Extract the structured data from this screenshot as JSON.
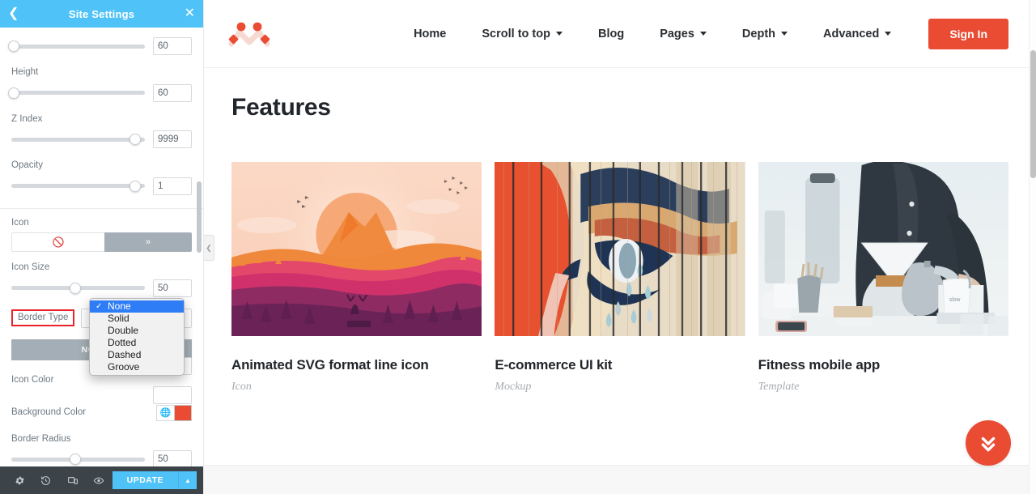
{
  "panel": {
    "header": {
      "title": "Site Settings",
      "back_icon": "chevron-left-icon",
      "close_icon": "close-icon"
    },
    "controls": [
      {
        "label": "",
        "value": "60",
        "knob_pct": 2
      },
      {
        "label": "Height",
        "value": "60",
        "knob_pct": 2
      },
      {
        "label": "Z Index",
        "value": "9999",
        "knob_pct": 93
      },
      {
        "label": "Opacity",
        "value": "1",
        "knob_pct": 93
      }
    ],
    "icon_section": {
      "label": "Icon",
      "picker_icon": "ban-icon",
      "more_icon": "double-chevron-down-icon"
    },
    "icon_size": {
      "label": "Icon Size",
      "value": "50",
      "knob_pct": 48
    },
    "border_type": {
      "label": "Border Type",
      "selected": "None"
    },
    "border_type_options": [
      {
        "label": "None",
        "selected": true
      },
      {
        "label": "Solid",
        "selected": false
      },
      {
        "label": "Double",
        "selected": false
      },
      {
        "label": "Dotted",
        "selected": false
      },
      {
        "label": "Dashed",
        "selected": false
      },
      {
        "label": "Groove",
        "selected": false
      }
    ],
    "tabs": [
      {
        "label": "NORMAL",
        "active": true
      }
    ],
    "icon_color": {
      "label": "Icon Color"
    },
    "background_color": {
      "label": "Background Color",
      "globe_icon": "globe-icon",
      "swatch_hex": "#ea4b33"
    },
    "border_radius": {
      "label": "Border Radius",
      "value": "50",
      "knob_pct": 48
    },
    "footer": {
      "icons": [
        {
          "name": "gear-icon",
          "glyph": "⚙"
        },
        {
          "name": "history-icon",
          "glyph": "↺"
        },
        {
          "name": "responsive-icon",
          "glyph": "▭"
        },
        {
          "name": "eye-icon",
          "glyph": "◉"
        }
      ],
      "update_label": "UPDATE",
      "update_arrow_icon": "chevron-up-icon"
    },
    "collapse_handle_icon": "chevron-left-icon"
  },
  "site": {
    "logo_name": "brand-logo",
    "nav": [
      {
        "label": "Home",
        "has_caret": false
      },
      {
        "label": "Scroll to top",
        "has_caret": true
      },
      {
        "label": "Blog",
        "has_caret": false
      },
      {
        "label": "Pages",
        "has_caret": true
      },
      {
        "label": "Depth",
        "has_caret": true
      },
      {
        "label": "Advanced",
        "has_caret": true
      }
    ],
    "signin_label": "Sign In",
    "section_title": "Features",
    "cards": [
      {
        "title": "Animated SVG format line icon",
        "subtitle": "Icon",
        "image": "sunset-mountain-forest-illustration"
      },
      {
        "title": "E-commerce UI kit",
        "subtitle": "Mockup",
        "image": "painted-eye-mural-on-wood-planks"
      },
      {
        "title": "Fitness mobile app",
        "subtitle": "Template",
        "image": "barista-pour-over-coffee-photo"
      }
    ],
    "scroll_button_icon": "double-chevron-down-icon"
  },
  "colors": {
    "panel_header": "#4fc3f7",
    "brand_red": "#ea4b33",
    "highlight_outline": "#e8242a",
    "dropdown_selected": "#2f7df6",
    "footer_dark": "#3c4449"
  }
}
